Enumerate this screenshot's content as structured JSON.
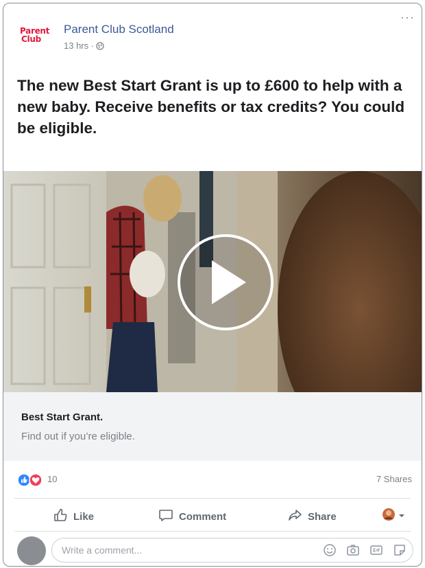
{
  "post": {
    "page_name": "Parent Club Scotland",
    "logo_text_line1": "Parent",
    "logo_text_line2": "Club",
    "time": "13 hrs ·",
    "more": "···",
    "text": "The new Best Start Grant is up to £600 to help with a new baby. Receive benefits or tax credits? You could be eligible."
  },
  "link": {
    "title": "Best Start Grant.",
    "subtitle": "Find out if you’re eligible."
  },
  "engagement": {
    "reaction_count": "10",
    "shares": "7 Shares"
  },
  "actions": {
    "like": "Like",
    "comment": "Comment",
    "share": "Share"
  },
  "comment_box": {
    "placeholder": "Write a comment..."
  },
  "colors": {
    "brand_blue": "#3b5998",
    "logo_red": "#e0183c",
    "like_blue": "#2d88ff",
    "love_red": "#f33e58"
  },
  "icons": [
    "globe-icon",
    "play-icon",
    "like-reaction-icon",
    "love-reaction-icon",
    "thumbs-up-icon",
    "comment-icon",
    "share-icon",
    "emoji-icon",
    "camera-icon",
    "gif-icon",
    "sticker-icon",
    "chevron-down-icon"
  ]
}
